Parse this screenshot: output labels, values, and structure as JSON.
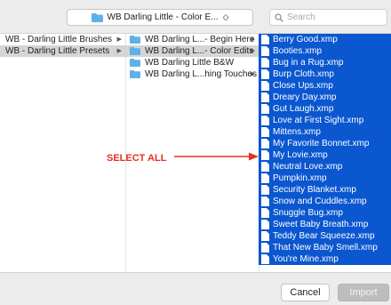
{
  "toolbar": {
    "location": "WB Darling Little - Color E...",
    "location_arrows": "◇",
    "search_placeholder": "Search"
  },
  "columns": {
    "col1": [
      {
        "label": "WB - Darling Little Brushes",
        "selected": false
      },
      {
        "label": "WB - Darling Little Presets",
        "selected": true
      }
    ],
    "col2": [
      {
        "label": "WB Darling L...- Begin Here",
        "selected": false,
        "has_children": true
      },
      {
        "label": "WB Darling L...- Color Edits",
        "selected": true,
        "has_children": true
      },
      {
        "label": "WB Darling Little B&W",
        "selected": false,
        "has_children": false
      },
      {
        "label": "WB Darling L...hing Touches",
        "selected": false,
        "has_children": true
      }
    ],
    "col3": [
      "Berry Good.xmp",
      "Booties.xmp",
      "Bug in a Rug.xmp",
      "Burp Cloth.xmp",
      "Close Ups.xmp",
      "Dreary Day.xmp",
      "Gut Laugh.xmp",
      "Love at First Sight.xmp",
      "Mittens.xmp",
      "My Favorite Bonnet.xmp",
      "My Lovie.xmp",
      "Neutral Love.xmp",
      "Pumpkin.xmp",
      "Security Blanket.xmp",
      "Snow and Cuddles.xmp",
      "Snuggle Bug.xmp",
      "Sweet Baby Breath.xmp",
      "Teddy Bear Squeeze.xmp",
      "That New Baby Smell.xmp",
      "You're Mine.xmp"
    ]
  },
  "annotation": {
    "text": "SELECT ALL",
    "color": "#e53022"
  },
  "buttons": {
    "cancel": "Cancel",
    "import": "Import"
  },
  "colors": {
    "selection": "#0b57d0",
    "folder": "#5fb0e8"
  }
}
